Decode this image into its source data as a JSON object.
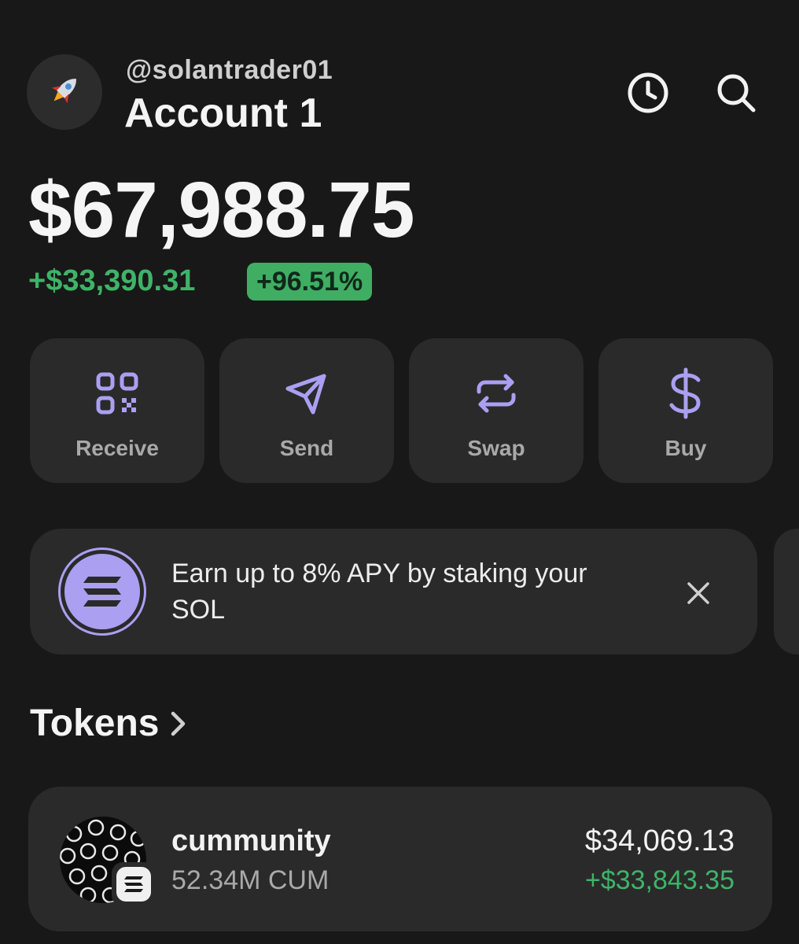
{
  "header": {
    "avatar_icon": "rocket-icon",
    "handle": "@solantrader01",
    "account_name": "Account 1",
    "history_icon": "clock-icon",
    "search_icon": "search-icon"
  },
  "portfolio": {
    "balance": "$67,988.75",
    "change": "+$33,390.31",
    "change_pct": "+96.51%"
  },
  "actions": [
    {
      "label": "Receive",
      "icon": "qr-code-icon"
    },
    {
      "label": "Send",
      "icon": "send-icon"
    },
    {
      "label": "Swap",
      "icon": "swap-icon"
    },
    {
      "label": "Buy",
      "icon": "dollar-icon"
    }
  ],
  "promo": {
    "text": "Earn up to 8% APY by staking your SOL",
    "icon": "solana-icon",
    "close_icon": "close-icon"
  },
  "tokens": {
    "title": "Tokens",
    "items": [
      {
        "name": "cummunity",
        "amount": "52.34M CUM",
        "value": "$34,069.13",
        "change": "+$33,843.35"
      }
    ]
  },
  "colors": {
    "background": "#181818",
    "card": "#2a2a2a",
    "accent": "#ab9ff2",
    "positive": "#3fb368"
  }
}
